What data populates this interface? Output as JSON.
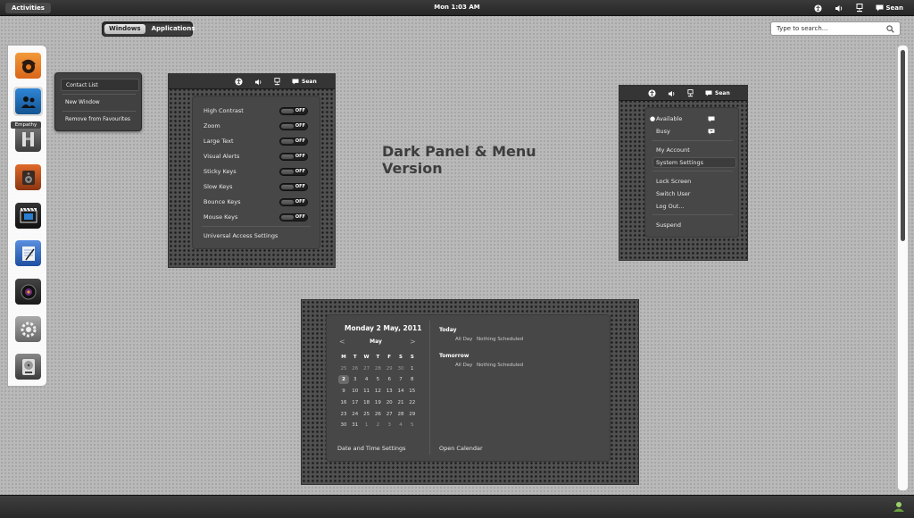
{
  "topbar": {
    "activities": "Activities",
    "clock": "Mon  1:03 AM",
    "user": "Sean",
    "tray_icons": [
      "accessibility-icon",
      "volume-icon",
      "network-icon",
      "chat-icon"
    ]
  },
  "overview": {
    "tabs": [
      {
        "label": "Windows",
        "active": true
      },
      {
        "label": "Applications",
        "active": false
      }
    ],
    "search_placeholder": "Type to search..."
  },
  "dash": {
    "apps": [
      {
        "name": "app-orange-icon",
        "color": "#e87a1e"
      },
      {
        "name": "empathy-icon",
        "color": "#1f6fb8"
      },
      {
        "name": "tools-icon",
        "color": "#5a5a5a"
      },
      {
        "name": "speaker-icon",
        "color": "#c15a22"
      },
      {
        "name": "video-icon",
        "color": "#2a2a2a"
      },
      {
        "name": "notes-icon",
        "color": "#3a6fc0"
      },
      {
        "name": "camera-icon",
        "color": "#2b2b2b"
      },
      {
        "name": "settings-icon",
        "color": "#8a8a8a"
      },
      {
        "name": "disk-icon",
        "color": "#5a5a5a"
      }
    ],
    "hover_label": "Empathy"
  },
  "context_menu": {
    "items": [
      "Contact List",
      "New Window",
      "Remove from Favourites"
    ]
  },
  "accessibility_menu": {
    "user": "Sean",
    "items": [
      {
        "label": "High Contrast",
        "state": "OFF"
      },
      {
        "label": "Zoom",
        "state": "OFF"
      },
      {
        "label": "Large Text",
        "state": "OFF"
      },
      {
        "label": "Visual Alerts",
        "state": "OFF"
      },
      {
        "label": "Sticky Keys",
        "state": "OFF"
      },
      {
        "label": "Slow Keys",
        "state": "OFF"
      },
      {
        "label": "Bounce Keys",
        "state": "OFF"
      },
      {
        "label": "Mouse Keys",
        "state": "OFF"
      }
    ],
    "settings": "Universal Access Settings"
  },
  "title": "Dark Panel & Menu Version",
  "status_menu": {
    "user": "Sean",
    "available": "Available",
    "busy": "Busy",
    "my_account": "My Account",
    "system_settings": "System Settings",
    "lock_screen": "Lock Screen",
    "switch_user": "Switch User",
    "log_out": "Log Out...",
    "suspend": "Suspend"
  },
  "calendar": {
    "header": "Monday  2 May, 2011",
    "month": "May",
    "weekdays": [
      "M",
      "T",
      "W",
      "T",
      "F",
      "S",
      "S"
    ],
    "weeks": [
      [
        "25",
        "26",
        "27",
        "28",
        "29",
        "30",
        "1"
      ],
      [
        "2",
        "3",
        "4",
        "5",
        "6",
        "7",
        "8"
      ],
      [
        "9",
        "10",
        "11",
        "12",
        "13",
        "14",
        "15"
      ],
      [
        "16",
        "17",
        "18",
        "19",
        "20",
        "21",
        "22"
      ],
      [
        "23",
        "24",
        "25",
        "26",
        "27",
        "28",
        "29"
      ],
      [
        "30",
        "31",
        "1",
        "2",
        "3",
        "4",
        "5"
      ]
    ],
    "today": "Today",
    "today_time": "All Day",
    "today_event": "Nothing Scheduled",
    "tomorrow": "Tomorrow",
    "tomorrow_time": "All Day",
    "tomorrow_event": "Nothing Scheduled",
    "date_settings": "Date and Time Settings",
    "open_calendar": "Open Calendar"
  }
}
